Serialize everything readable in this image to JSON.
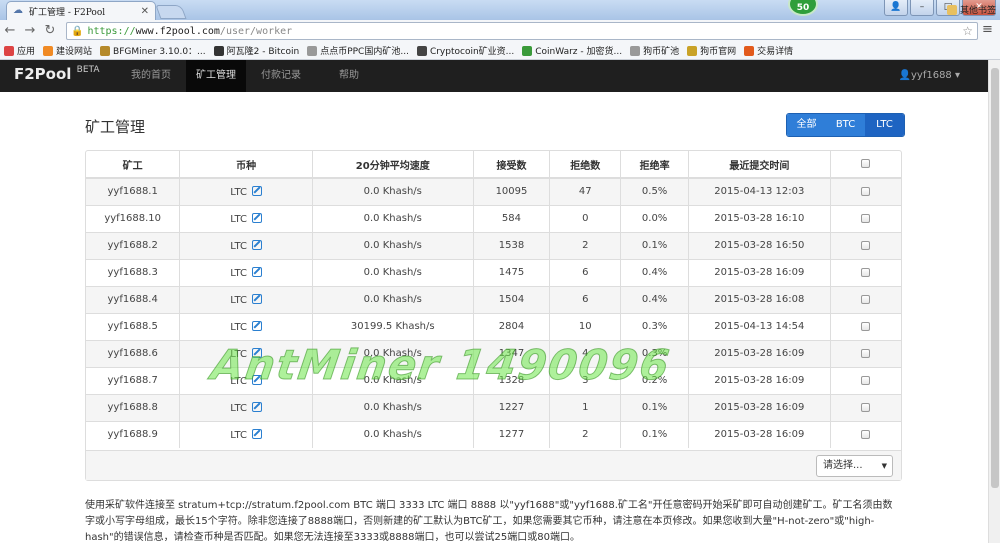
{
  "browser": {
    "tab_title": "矿工管理 - F2Pool",
    "url_scheme": "https://",
    "url_host": "www.f2pool.com",
    "url_path": "/user/worker",
    "badge": "50",
    "bookmarks": [
      {
        "label": "应用",
        "icon_color": "#d44"
      },
      {
        "label": "建设网站",
        "icon_color": "#f08a24"
      },
      {
        "label": "BFGMiner 3.10.0：...",
        "icon_color": "#b58a2b"
      },
      {
        "label": "阿瓦隆2 - Bitcoin",
        "icon_color": "#333"
      },
      {
        "label": "点点币PPC国内矿池...",
        "icon_color": "#999"
      },
      {
        "label": "Cryptocoin矿业资...",
        "icon_color": "#444"
      },
      {
        "label": "CoinWarz - 加密货...",
        "icon_color": "#3a9a3a"
      },
      {
        "label": "狗币矿池",
        "icon_color": "#999"
      },
      {
        "label": "狗币官网",
        "icon_color": "#c9a227"
      },
      {
        "label": "交易详情",
        "icon_color": "#e25a1c"
      }
    ],
    "bookmarks_more": "其他书签"
  },
  "nav": {
    "brand": "F2Pool",
    "brand_sup": "BETA",
    "items": [
      "我的首页",
      "矿工管理",
      "付款记录",
      "帮助"
    ],
    "user": "yyf1688"
  },
  "page": {
    "title": "矿工管理",
    "filters": [
      "全部",
      "BTC",
      "LTC"
    ]
  },
  "table": {
    "headers": [
      "矿工",
      "币种",
      "20分钟平均速度",
      "接受数",
      "拒绝数",
      "拒绝率",
      "最近提交时间"
    ],
    "rows": [
      {
        "worker": "yyf1688.1",
        "coin": "LTC",
        "speed": "0.0 Khash/s",
        "accepted": "10095",
        "rejected": "47",
        "rate": "0.5%",
        "last": "2015-04-13 12:03"
      },
      {
        "worker": "yyf1688.10",
        "coin": "LTC",
        "speed": "0.0 Khash/s",
        "accepted": "584",
        "rejected": "0",
        "rate": "0.0%",
        "last": "2015-03-28 16:10"
      },
      {
        "worker": "yyf1688.2",
        "coin": "LTC",
        "speed": "0.0 Khash/s",
        "accepted": "1538",
        "rejected": "2",
        "rate": "0.1%",
        "last": "2015-03-28 16:50"
      },
      {
        "worker": "yyf1688.3",
        "coin": "LTC",
        "speed": "0.0 Khash/s",
        "accepted": "1475",
        "rejected": "6",
        "rate": "0.4%",
        "last": "2015-03-28 16:09"
      },
      {
        "worker": "yyf1688.4",
        "coin": "LTC",
        "speed": "0.0 Khash/s",
        "accepted": "1504",
        "rejected": "6",
        "rate": "0.4%",
        "last": "2015-03-28 16:08"
      },
      {
        "worker": "yyf1688.5",
        "coin": "LTC",
        "speed": "30199.5 Khash/s",
        "accepted": "2804",
        "rejected": "10",
        "rate": "0.3%",
        "last": "2015-04-13 14:54"
      },
      {
        "worker": "yyf1688.6",
        "coin": "LTC",
        "speed": "0.0 Khash/s",
        "accepted": "1347",
        "rejected": "4",
        "rate": "0.3%",
        "last": "2015-03-28 16:09"
      },
      {
        "worker": "yyf1688.7",
        "coin": "LTC",
        "speed": "0.0 Khash/s",
        "accepted": "1328",
        "rejected": "3",
        "rate": "0.2%",
        "last": "2015-03-28 16:09"
      },
      {
        "worker": "yyf1688.8",
        "coin": "LTC",
        "speed": "0.0 Khash/s",
        "accepted": "1227",
        "rejected": "1",
        "rate": "0.1%",
        "last": "2015-03-28 16:09"
      },
      {
        "worker": "yyf1688.9",
        "coin": "LTC",
        "speed": "0.0 Khash/s",
        "accepted": "1277",
        "rejected": "2",
        "rate": "0.1%",
        "last": "2015-03-28 16:09"
      }
    ],
    "select_label": "请选择..."
  },
  "info_text": "使用采矿软件连接至 stratum+tcp://stratum.f2pool.com BTC 端口 3333 LTC 端口 8888 以\"yyf1688\"或\"yyf1688.矿工名\"开任意密码开始采矿即可自动创建矿工。矿工名须由数字或小写字母组成，最长15个字符。除非您连接了8888端口，否则新建的矿工默认为BTC矿工，如果您需要其它币种，请注意在本页修改。如果您收到大量\"H-not-zero\"或\"high-hash\"的错误信息，请检查币种是否匹配。如果您无法连接至3333或8888端口，也可以尝试25端口或80端口。",
  "watermark": "AntMiner 1490096"
}
